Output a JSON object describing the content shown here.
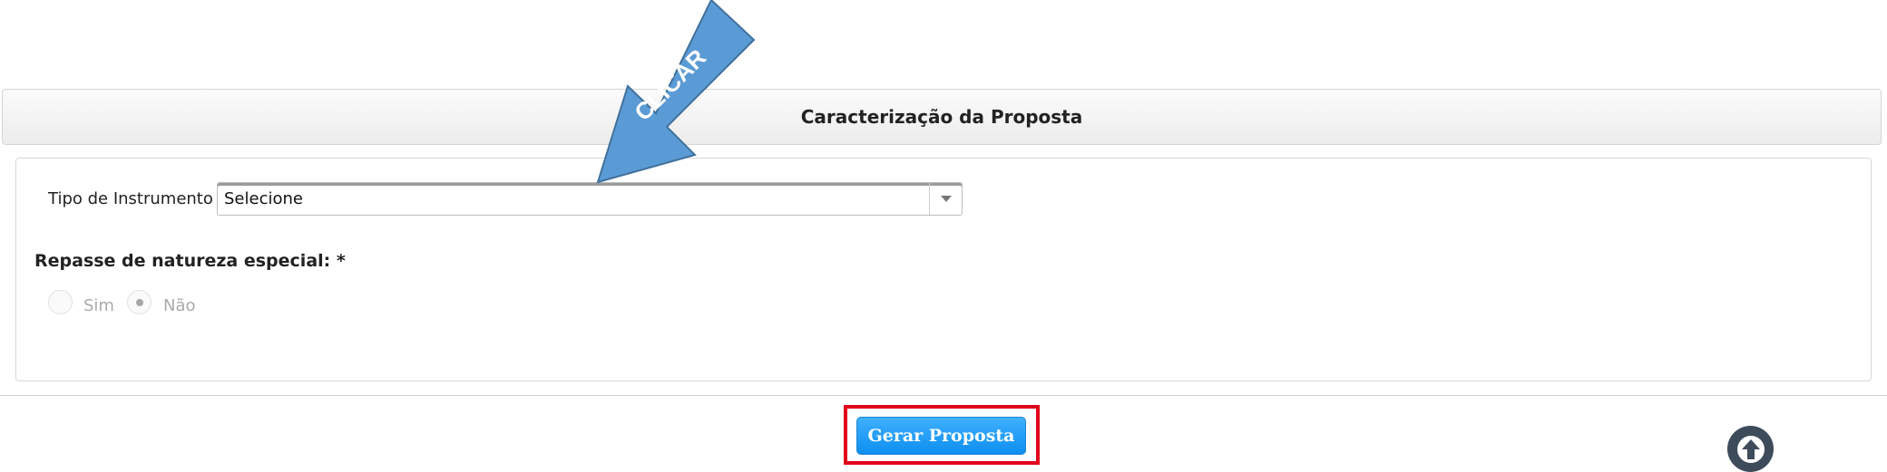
{
  "section": {
    "title": "Caracterização da Proposta"
  },
  "form": {
    "tipo_instrumento": {
      "label": "Tipo de Instrumento",
      "value": "Selecione"
    },
    "repasse": {
      "label": "Repasse de natureza especial: *",
      "options": [
        {
          "label": "Sim",
          "selected": false
        },
        {
          "label": "Não",
          "selected": true
        }
      ]
    }
  },
  "actions": {
    "submit_label": "Gerar Proposta"
  },
  "annotation": {
    "arrow_text": "CLICAR",
    "arrow_color": "#5b9bd5",
    "highlight_color": "#e1001a"
  },
  "colors": {
    "primary_button": "#1a9af5",
    "scroll_top": "#3d4b5a"
  },
  "icons": {
    "select_toggle": "chevron-down-icon",
    "scroll_top": "arrow-up-icon"
  }
}
